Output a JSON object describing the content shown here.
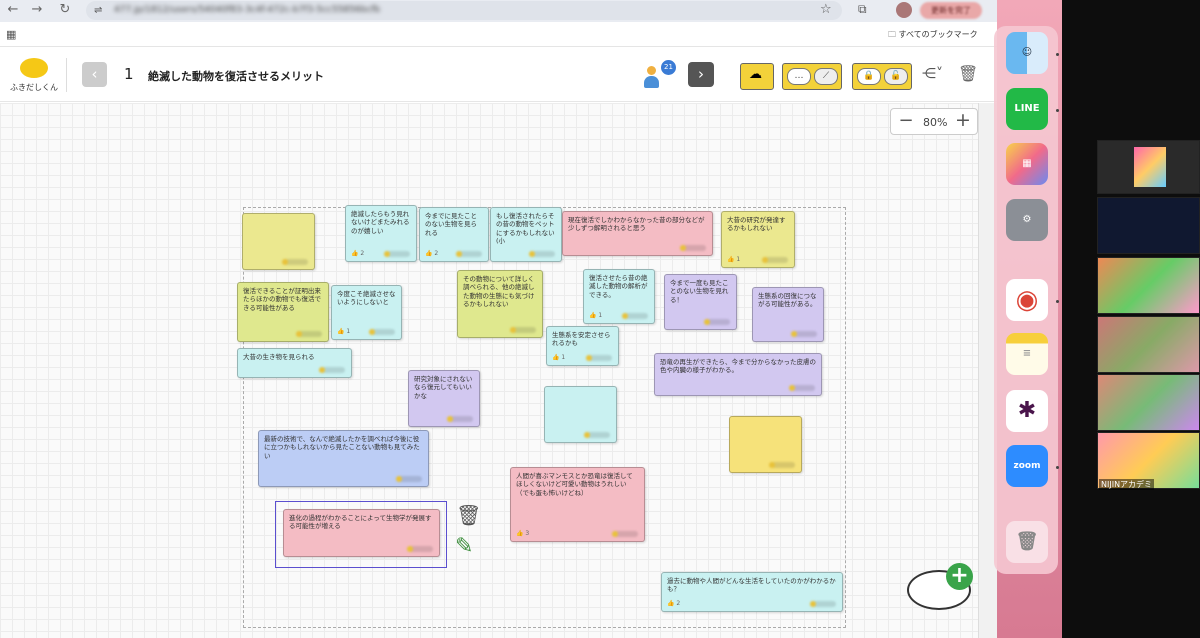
{
  "browser": {
    "url": "477.jp/1812/users/54040f83-3c4f-472c-b7f3-5cc55856bcfb",
    "update_label": "更新を完了",
    "bookmark_folder": "すべてのブックマーク"
  },
  "app": {
    "logo_text": "ふきだしくん",
    "page_number": "1",
    "page_title": "絶滅した動物を復活させるメリット",
    "user_count": "21",
    "zoom_level": "80%"
  },
  "notes": [
    {
      "text": "",
      "likes": ""
    },
    {
      "text": "絶滅したらもう見れないけどまたみれるのが嬉しい",
      "likes": "2"
    },
    {
      "text": "今までに見たことのない生物を見られる",
      "likes": "2"
    },
    {
      "text": "もし復活されたらその昔の動物をペットにするかもしれない(小",
      "likes": ""
    },
    {
      "text": "現在復活でしかわからなかった昔の部分などが少しずつ解明されると思う",
      "likes": ""
    },
    {
      "text": "大昔の研究が発達するかもしれない",
      "likes": "1"
    },
    {
      "text": "復活できることが証明出来たらほかの動物でも復活できる可能性がある",
      "likes": ""
    },
    {
      "text": "今度こそ絶滅させないようにしないと",
      "likes": "1"
    },
    {
      "text": "その動物について詳しく調べられる、他の絶滅した動物の生態にも気づけるかもしれない",
      "likes": ""
    },
    {
      "text": "復活させたら昔の絶滅した動物の解析ができる。",
      "likes": "1"
    },
    {
      "text": "今まで一度も見たことのない生物を見れる！",
      "likes": ""
    },
    {
      "text": "生態系の回復につながる可能性がある。",
      "likes": ""
    },
    {
      "text": "生態系を安定させられるかも",
      "likes": "1"
    },
    {
      "text": "大昔の生き物を見られる",
      "likes": ""
    },
    {
      "text": "恐竜の再生ができたら、今まで分からなかった皮膚の色や内臓の様子がわかる。",
      "likes": ""
    },
    {
      "text": "研究対象にされないなら復元してもいいかな",
      "likes": ""
    },
    {
      "text": "",
      "likes": ""
    },
    {
      "text": "最新の技術で、なんで絶滅したかを調べれば今後に役に立つかもしれないから見たことない動物も見てみたい",
      "likes": ""
    },
    {
      "text": "",
      "likes": ""
    },
    {
      "text": "人間が喜ぶマンモスとか恐竜は復活してほしくないけど可愛い動物はうれしい（でも蛋も怖いけどね）",
      "likes": "3"
    },
    {
      "text": "進化の過程がわかることによって生物学が発展する可能性が増える",
      "likes": ""
    },
    {
      "text": "過去に動物や人間がどんな生活をしていたのかがわかるかも？",
      "likes": "2"
    }
  ],
  "dock": [
    "Finder",
    "LINE",
    "Launchpad",
    "System Settings",
    "Chrome",
    "Notes",
    "Slack",
    "zoom",
    "Trash"
  ],
  "zoom_panel": {
    "name_tag": "NIJINアカデミ"
  },
  "colors": {
    "accent_yellow": "#f3d23a",
    "selection": "#5b4fcf",
    "add_button": "#3aa44a"
  }
}
